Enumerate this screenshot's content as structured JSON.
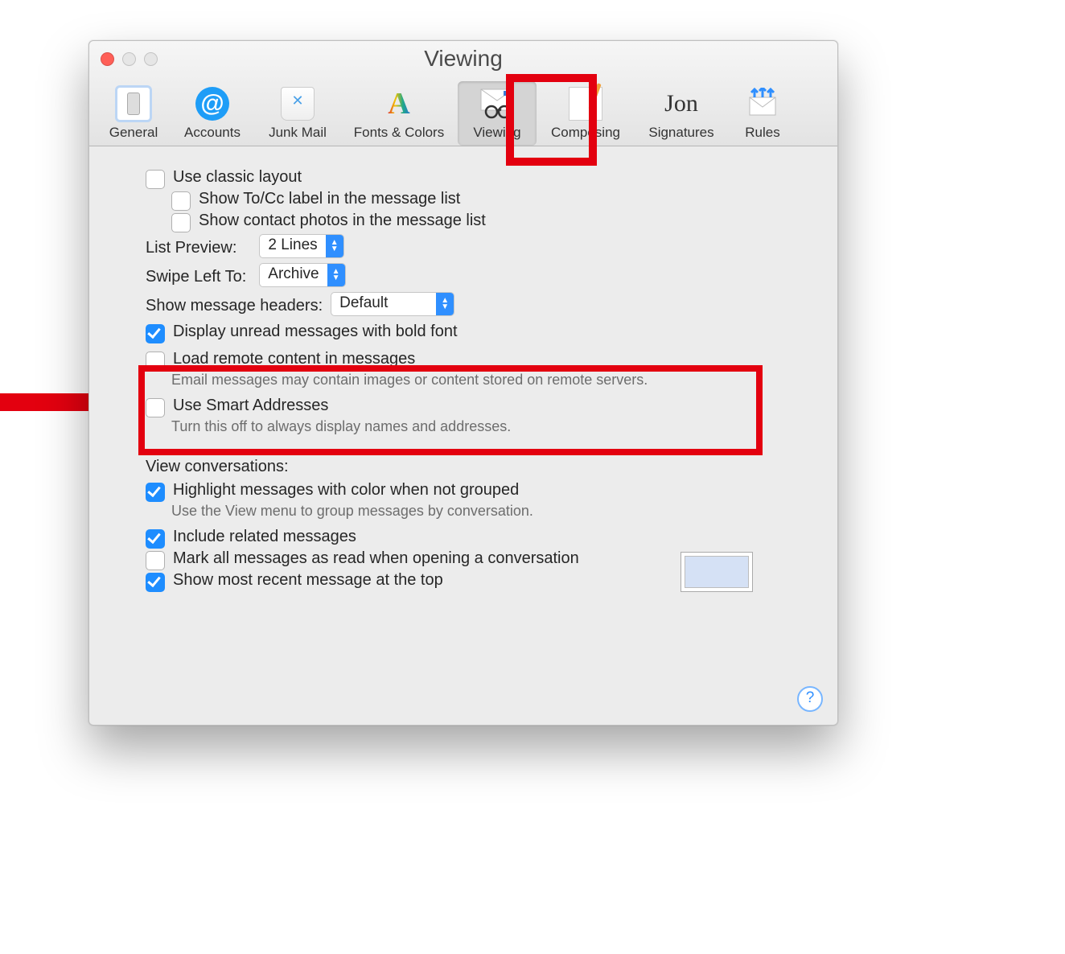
{
  "window": {
    "title": "Viewing"
  },
  "toolbar": {
    "general": "General",
    "accounts": "Accounts",
    "junk": "Junk Mail",
    "fonts": "Fonts & Colors",
    "viewing": "Viewing",
    "composing": "Composing",
    "signatures": "Signatures",
    "rules": "Rules"
  },
  "opts": {
    "classic": "Use classic layout",
    "tocc": "Show To/Cc label in the message list",
    "photos": "Show contact photos in the message list",
    "listpreview_label": "List Preview:",
    "listpreview_value": "2 Lines",
    "swipe_label": "Swipe Left To:",
    "swipe_value": "Archive",
    "headers_label": "Show message headers:",
    "headers_value": "Default",
    "bold": "Display unread messages with bold font",
    "remote": "Load remote content in messages",
    "remote_sub": "Email messages may contain images or content stored on remote servers.",
    "smart": "Use Smart Addresses",
    "smart_sub": "Turn this off to always display names and addresses.",
    "conv_header": "View conversations:",
    "hl": "Highlight messages with color when not grouped",
    "hl_sub": "Use the View menu to group messages by conversation.",
    "related": "Include related messages",
    "markread": "Mark all messages as read when opening a conversation",
    "recent": "Show most recent message at the top"
  },
  "help": "?"
}
